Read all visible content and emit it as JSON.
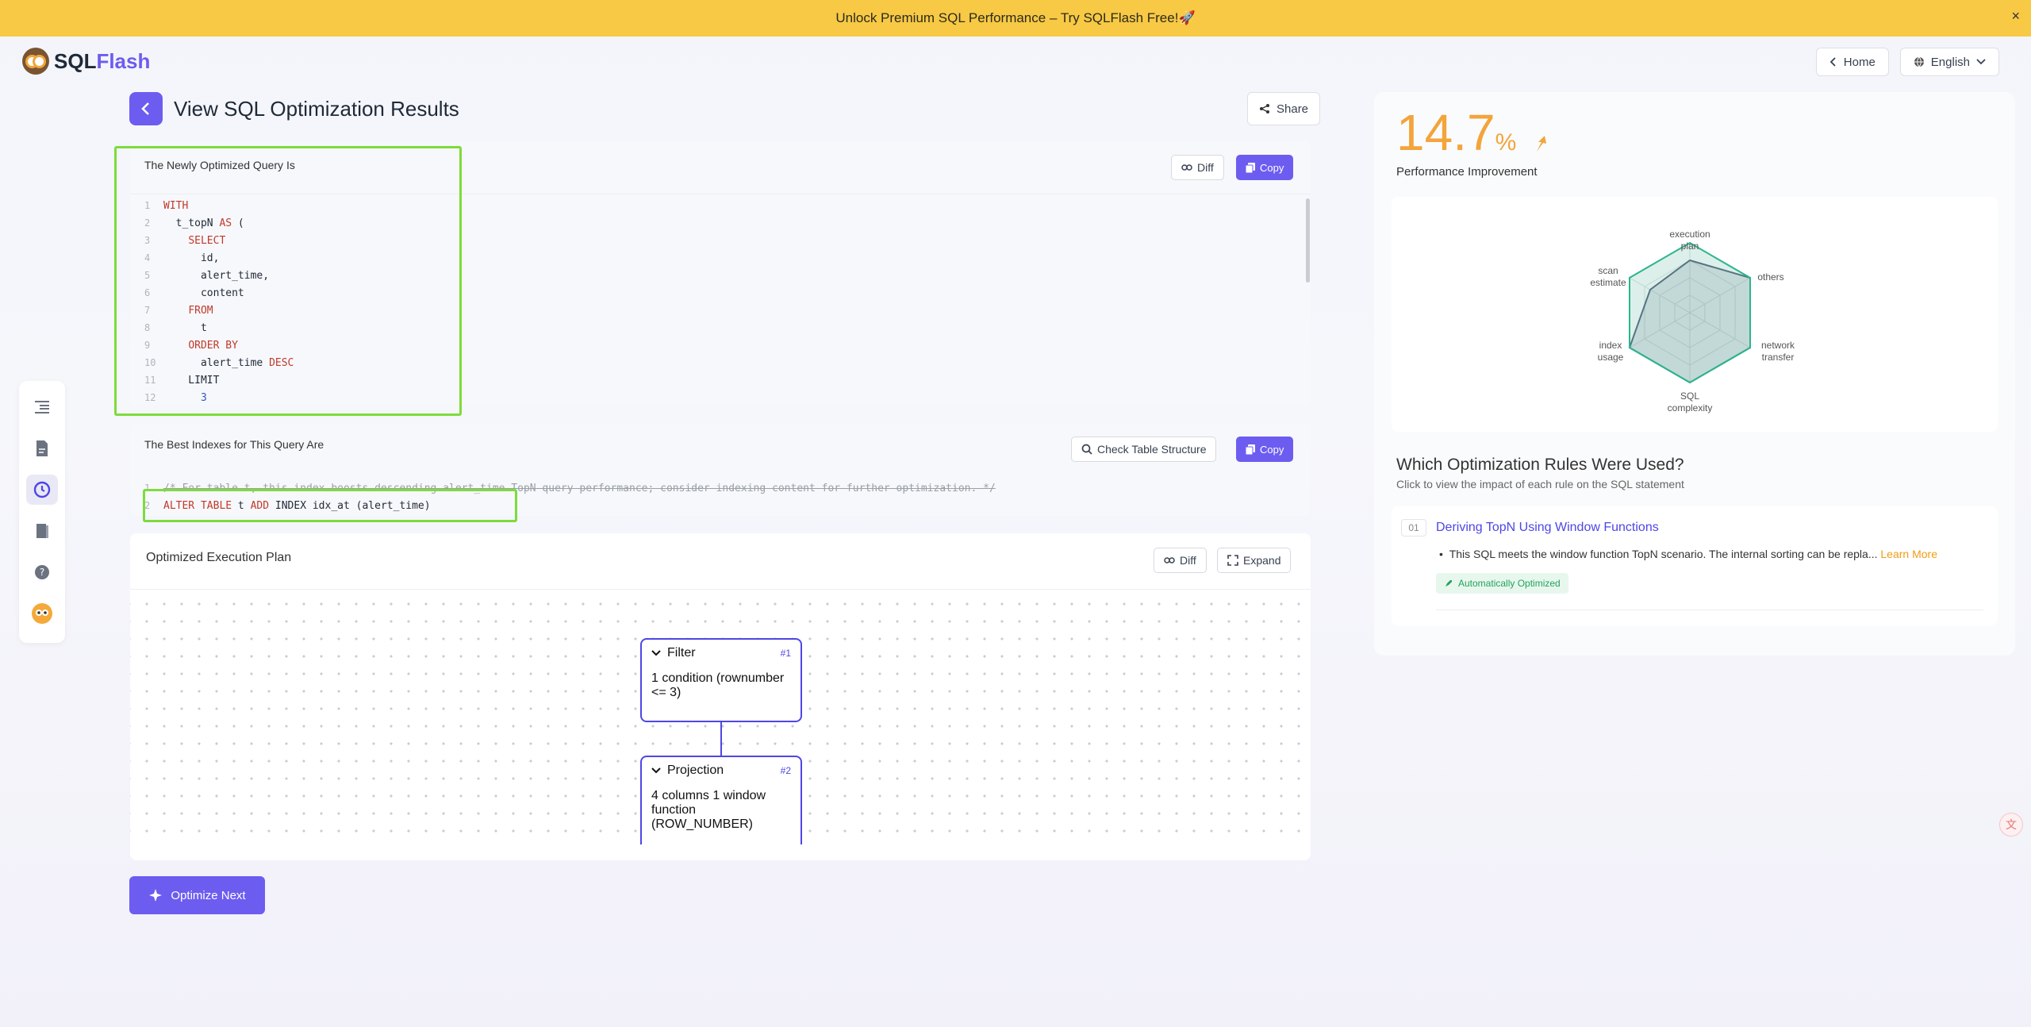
{
  "banner": {
    "text": "Unlock Premium SQL Performance – Try SQLFlash Free!🚀",
    "close": "×"
  },
  "logo": {
    "part1": "SQL",
    "part2": "Flash"
  },
  "nav": {
    "home": "Home",
    "language": "English"
  },
  "page": {
    "title": "View SQL Optimization Results",
    "share": "Share"
  },
  "query_card": {
    "title": "The Newly Optimized Query Is",
    "diff": "Diff",
    "copy": "Copy",
    "lines": [
      {
        "n": "1",
        "parts": [
          {
            "t": "WITH",
            "c": "kw"
          }
        ]
      },
      {
        "n": "2",
        "parts": [
          {
            "t": "  t_topN ",
            "c": ""
          },
          {
            "t": "AS",
            "c": "kw"
          },
          {
            "t": " (",
            "c": ""
          }
        ]
      },
      {
        "n": "3",
        "parts": [
          {
            "t": "    ",
            "c": ""
          },
          {
            "t": "SELECT",
            "c": "kw"
          }
        ]
      },
      {
        "n": "4",
        "parts": [
          {
            "t": "      id,",
            "c": ""
          }
        ]
      },
      {
        "n": "5",
        "parts": [
          {
            "t": "      alert_time,",
            "c": ""
          }
        ]
      },
      {
        "n": "6",
        "parts": [
          {
            "t": "      content",
            "c": ""
          }
        ]
      },
      {
        "n": "7",
        "parts": [
          {
            "t": "    ",
            "c": ""
          },
          {
            "t": "FROM",
            "c": "kw"
          }
        ]
      },
      {
        "n": "8",
        "parts": [
          {
            "t": "      t",
            "c": ""
          }
        ]
      },
      {
        "n": "9",
        "parts": [
          {
            "t": "    ",
            "c": ""
          },
          {
            "t": "ORDER BY",
            "c": "kw"
          }
        ]
      },
      {
        "n": "10",
        "parts": [
          {
            "t": "      alert_time ",
            "c": ""
          },
          {
            "t": "DESC",
            "c": "kw"
          }
        ]
      },
      {
        "n": "11",
        "parts": [
          {
            "t": "    LIMIT",
            "c": ""
          }
        ]
      },
      {
        "n": "12",
        "parts": [
          {
            "t": "      ",
            "c": ""
          },
          {
            "t": "3",
            "c": "num"
          }
        ]
      }
    ]
  },
  "index_card": {
    "title": "The Best Indexes for This Query Are",
    "check": "Check Table Structure",
    "copy": "Copy",
    "lines": [
      {
        "n": "1",
        "parts": [
          {
            "t": "/* For table t, this index boosts descending alert_time TopN query performance; consider indexing content for further optimization. */",
            "c": "cm"
          }
        ]
      },
      {
        "n": "2",
        "parts": [
          {
            "t": "ALTER TABLE",
            "c": "kw"
          },
          {
            "t": " t ",
            "c": ""
          },
          {
            "t": "ADD",
            "c": "kw"
          },
          {
            "t": " INDEX idx_at (alert_time)",
            "c": ""
          }
        ]
      }
    ]
  },
  "plan_card": {
    "title": "Optimized Execution Plan",
    "diff": "Diff",
    "expand": "Expand",
    "nodes": [
      {
        "name": "Filter",
        "id": "#1",
        "detail": "1 condition (rownumber <= 3)"
      },
      {
        "name": "Projection",
        "id": "#2",
        "detail": "4 columns 1 window function (ROW_NUMBER)"
      }
    ]
  },
  "optimize_next": "Optimize Next",
  "performance": {
    "value": "14.7",
    "unit": "%",
    "label": "Performance Improvement"
  },
  "radar": {
    "labels": {
      "top": "execution plan",
      "top_right": "others",
      "bottom_right_1": "network",
      "bottom_right_2": "transfer",
      "bottom": "SQL complexity",
      "bottom_left_1": "index",
      "bottom_left_2": "usage",
      "top_left_1": "scan",
      "top_left_2": "estimate"
    },
    "before_color": "#5a6c80",
    "after_color": "#2bb58f"
  },
  "rules": {
    "title": "Which Optimization Rules Were Used?",
    "subtitle": "Click to view the impact of each rule on the SQL statement",
    "items": [
      {
        "index": "01",
        "name": "Deriving TopN Using Window Functions",
        "desc": "This SQL meets the window function TopN scenario. The internal sorting can be repla...",
        "learn_more": "Learn More",
        "badge": "Automatically Optimized"
      }
    ]
  },
  "colors": {
    "accent": "#6d5cf0",
    "banner": "#f7c944",
    "highlight": "#7ddc3c",
    "perf": "#f3a43b"
  }
}
